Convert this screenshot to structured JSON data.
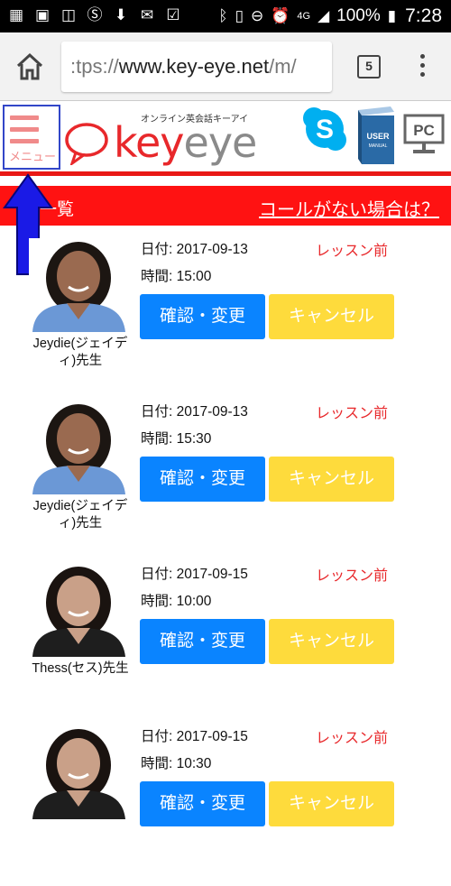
{
  "status_bar": {
    "battery": "100%",
    "time": "7:28",
    "network": "4G",
    "left_icons": [
      "calendar-icon",
      "contact-icon",
      "market-icon",
      "skype-icon",
      "download-icon",
      "mail-icon",
      "check-icon"
    ],
    "right_icons": [
      "bluetooth-icon",
      "vibrate-icon",
      "do-not-disturb-icon",
      "alarm-icon",
      "signal-icon",
      "battery-icon"
    ]
  },
  "browser": {
    "url_scheme": ":tps://",
    "url_host": "www.key-eye.net",
    "url_path": "/m/",
    "tab_count": "5"
  },
  "header": {
    "menu_label": "メニュー",
    "logo_tagline": "オンライン英会話キーアイ",
    "logo_key": "key",
    "logo_eye": "eye",
    "manual_label_user": "USER",
    "manual_label_manual": "MANUAL",
    "pc_label": "PC"
  },
  "red_bar": {
    "title": "一覧",
    "link": "コールがない場合は？"
  },
  "lessons": [
    {
      "teacher": "Jeydie(ジェイディ)先生",
      "date": "日付: 2017-09-13",
      "time": "時間: 15:00",
      "status": "レッスン前",
      "confirm": "確認・変更",
      "cancel": "キャンセル"
    },
    {
      "teacher": "Jeydie(ジェイディ)先生",
      "date": "日付: 2017-09-13",
      "time": "時間: 15:30",
      "status": "レッスン前",
      "confirm": "確認・変更",
      "cancel": "キャンセル"
    },
    {
      "teacher": "Thess(セス)先生",
      "date": "日付: 2017-09-15",
      "time": "時間: 10:00",
      "status": "レッスン前",
      "confirm": "確認・変更",
      "cancel": "キャンセル"
    },
    {
      "teacher": "",
      "date": "日付: 2017-09-15",
      "time": "時間: 10:30",
      "status": "レッスン前",
      "confirm": "確認・変更",
      "cancel": "キャンセル"
    }
  ],
  "colors": {
    "accent_red": "#e8282b",
    "bar_red": "#ff1212",
    "confirm_blue": "#0a84ff",
    "cancel_yellow": "#fedb3c",
    "arrow_blue": "#1a1ae6"
  }
}
